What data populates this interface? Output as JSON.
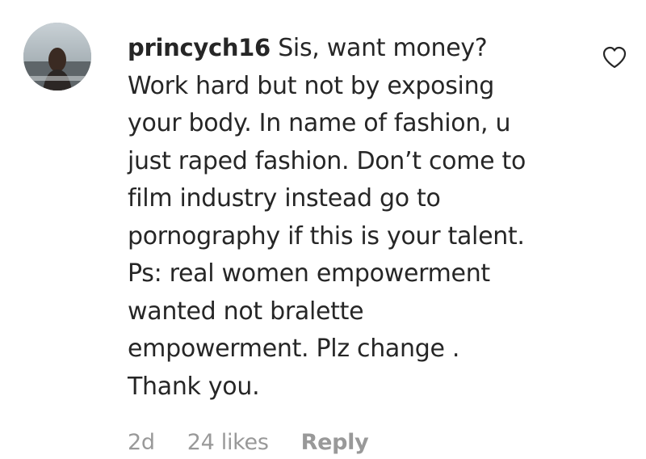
{
  "comment": {
    "username": "princych16",
    "text_lines": [
      "Sis, want money?",
      "Work hard but not by exposing",
      "your body. In name of fashion, u",
      "just raped fashion. Don’t come to",
      "film industry instead go to",
      "pornography if this is your talent.",
      "Ps: real women empowerment",
      "wanted not bralette",
      "empowerment. Plz change .",
      "Thank you."
    ],
    "time": "2d",
    "likes": "24 likes",
    "reply_label": "Reply",
    "like_icon": "heart-icon",
    "colors": {
      "text": "#262626",
      "meta": "#999999",
      "heart_stroke": "#262626"
    }
  }
}
